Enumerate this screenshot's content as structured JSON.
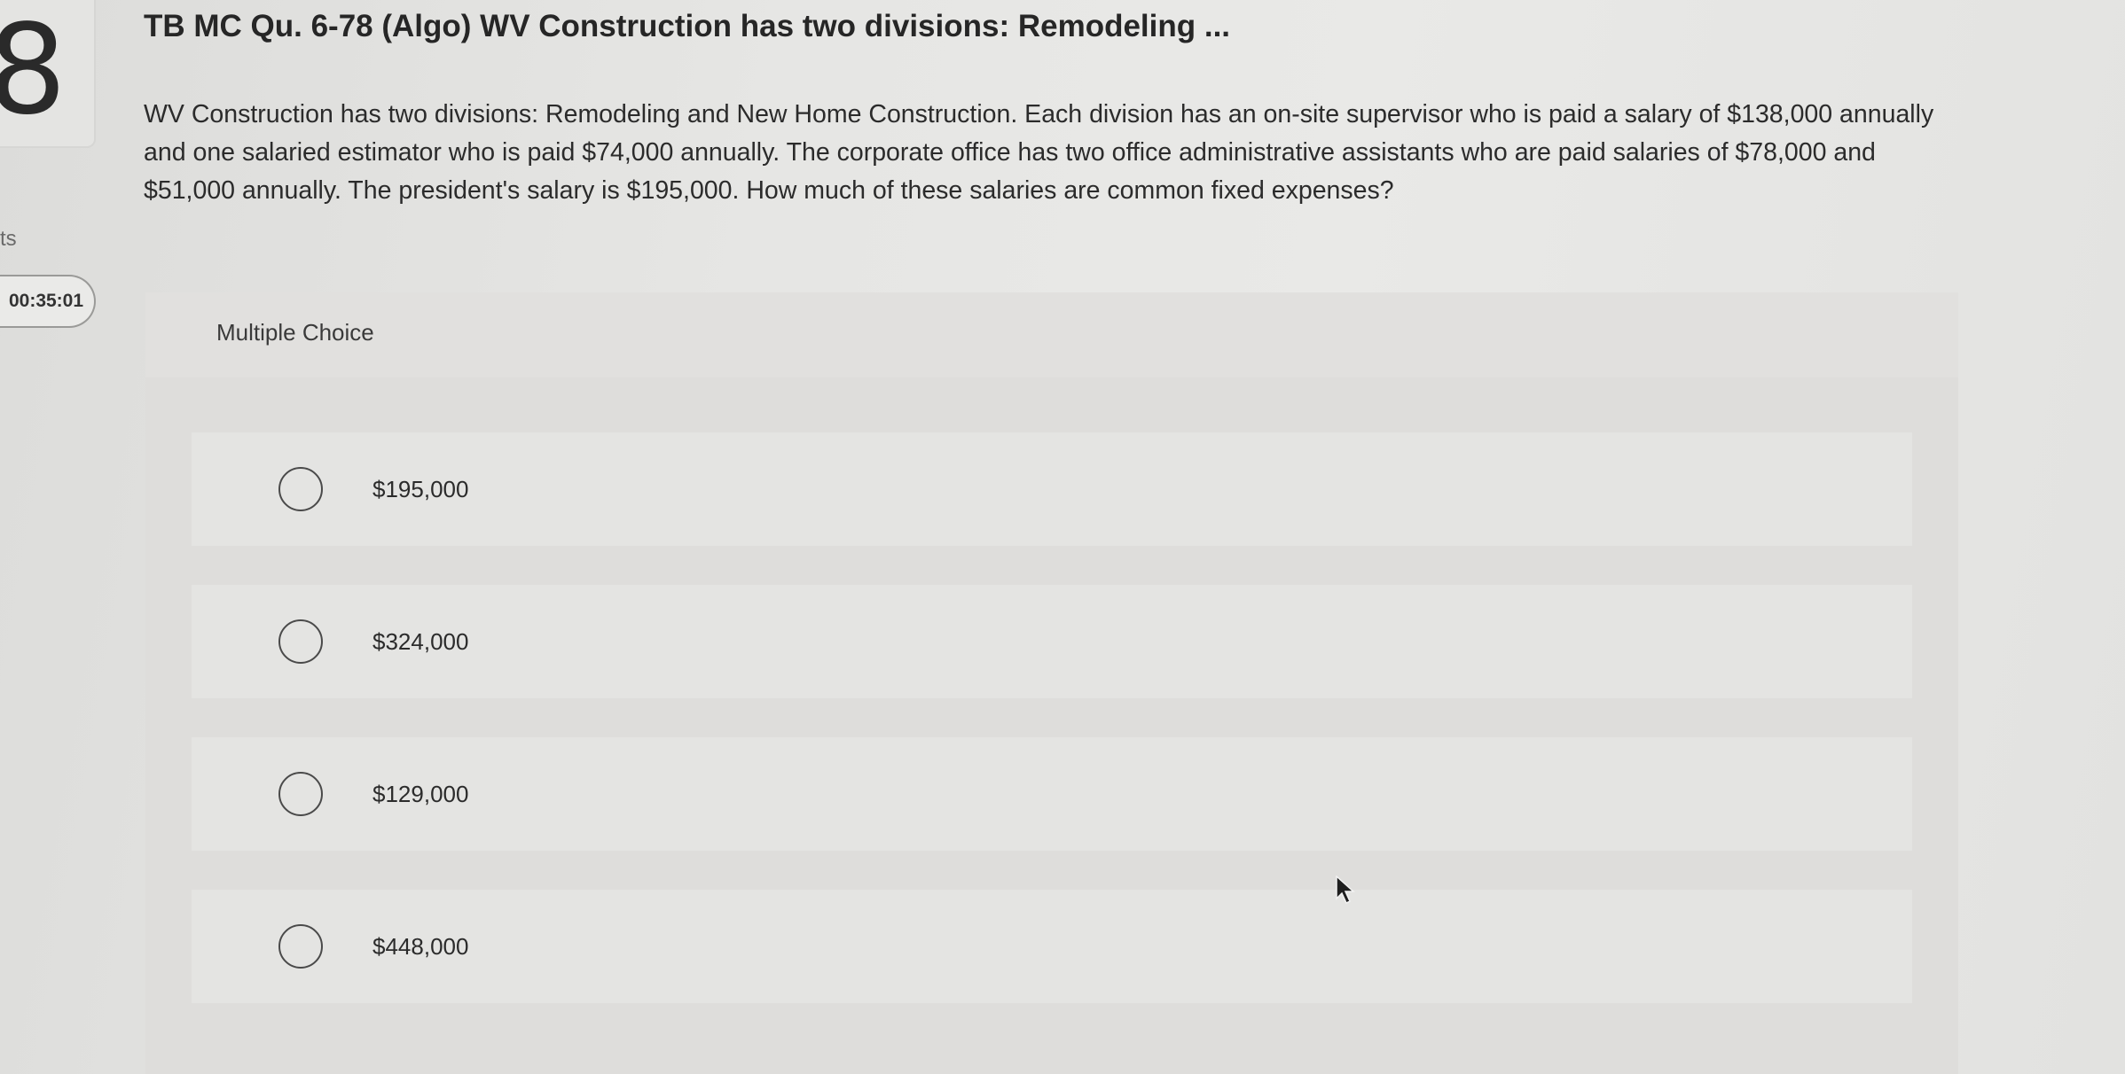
{
  "question": {
    "number": "8",
    "points_label": "ts",
    "timer": "00:35:01",
    "title": "TB MC Qu. 6-78 (Algo) WV Construction has two divisions: Remodeling ...",
    "body": "WV Construction has two divisions: Remodeling and New Home Construction. Each division has an on-site supervisor who is paid a salary of $138,000 annually and one salaried estimator who is paid $74,000 annually. The corporate office has two office administrative assistants who are paid salaries of $78,000 and $51,000 annually. The president's salary is $195,000. How much of these salaries are common fixed expenses?"
  },
  "choices": {
    "heading": "Multiple Choice",
    "options": [
      {
        "label": "$195,000"
      },
      {
        "label": "$324,000"
      },
      {
        "label": "$129,000"
      },
      {
        "label": "$448,000"
      }
    ]
  },
  "icons": {
    "radio": "radio-empty-icon",
    "cursor": "mouse-pointer-icon"
  }
}
